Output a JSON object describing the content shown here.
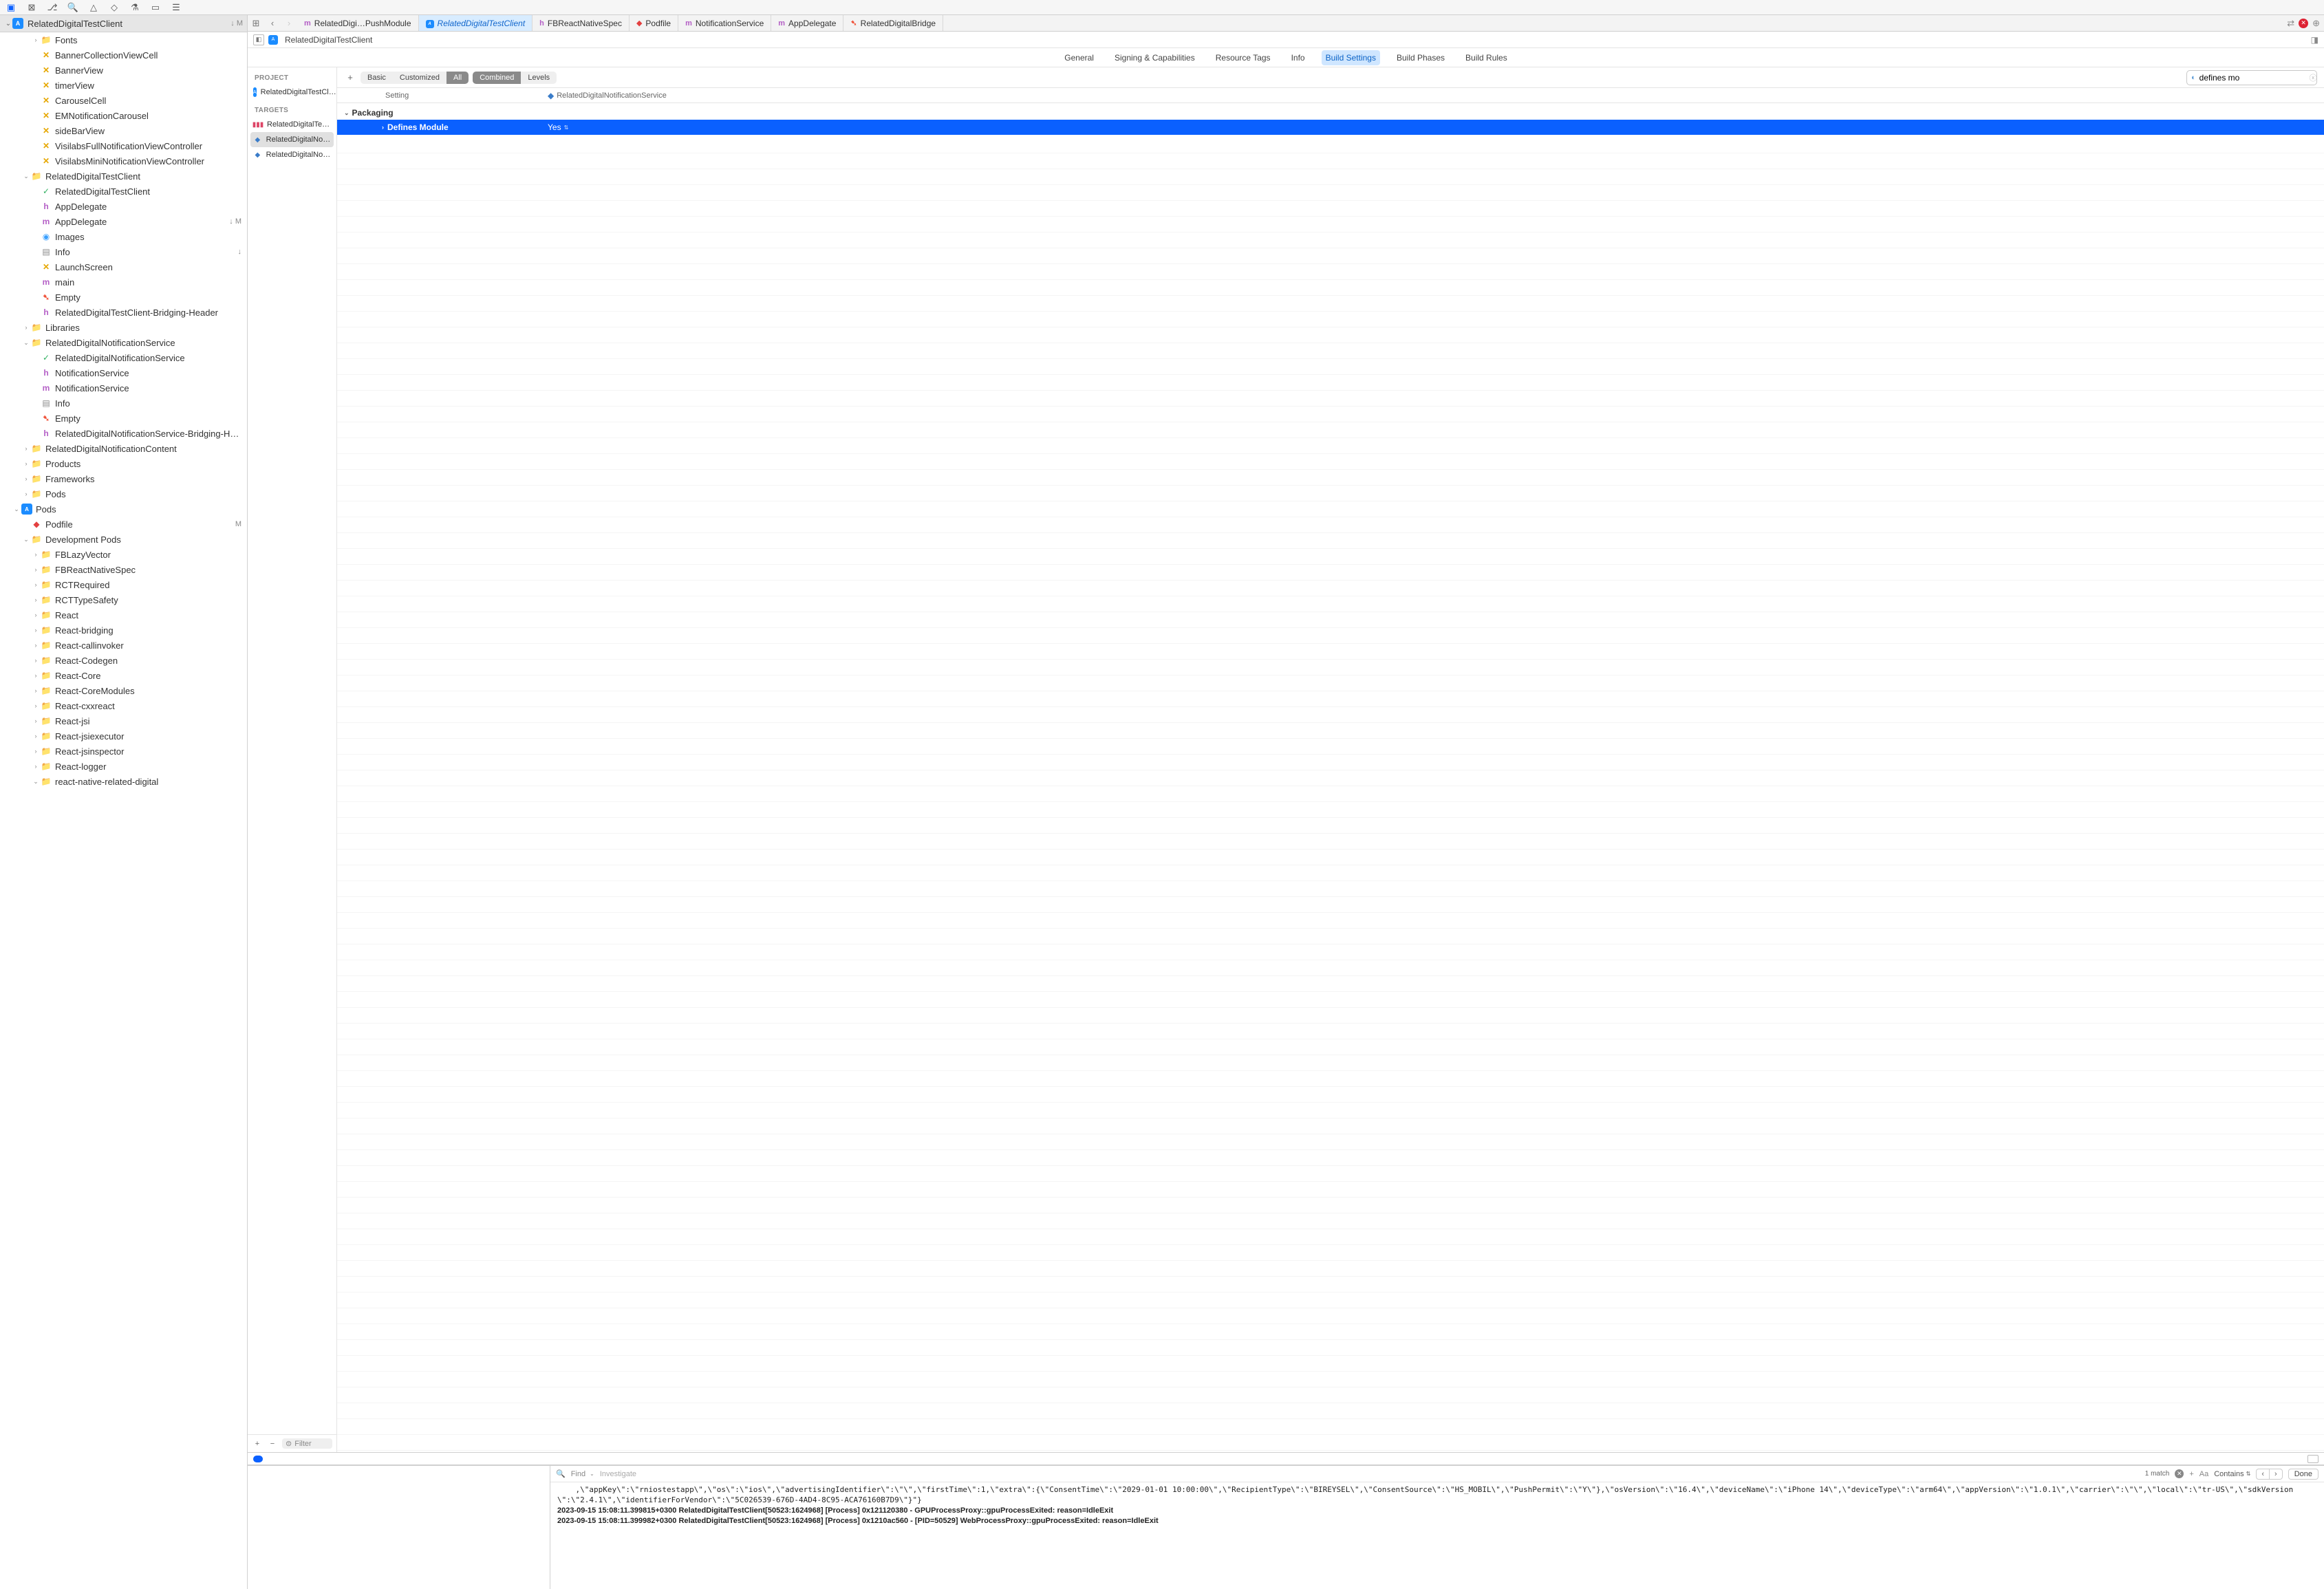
{
  "toolbar_icons": [
    "finder",
    "square-x",
    "branch",
    "search",
    "warn",
    "tag",
    "flask",
    "rect",
    "panel"
  ],
  "project_header": {
    "name": "RelatedDigitalTestClient",
    "status": "↓ M"
  },
  "nav_tree": [
    {
      "indent": 1,
      "disc": "›",
      "icon": "folder",
      "label": "Fonts"
    },
    {
      "indent": 1,
      "disc": "",
      "icon": "xib",
      "label": "BannerCollectionViewCell"
    },
    {
      "indent": 1,
      "disc": "",
      "icon": "xib",
      "label": "BannerView"
    },
    {
      "indent": 1,
      "disc": "",
      "icon": "xib",
      "label": "timerView"
    },
    {
      "indent": 1,
      "disc": "",
      "icon": "xib",
      "label": "CarouselCell"
    },
    {
      "indent": 1,
      "disc": "",
      "icon": "xib",
      "label": "EMNotificationCarousel"
    },
    {
      "indent": 1,
      "disc": "",
      "icon": "xib",
      "label": "sideBarView"
    },
    {
      "indent": 1,
      "disc": "",
      "icon": "xib",
      "label": "VisilabsFullNotificationViewController"
    },
    {
      "indent": 1,
      "disc": "",
      "icon": "xib",
      "label": "VisilabsMiniNotificationViewController"
    },
    {
      "indent": 0,
      "disc": "⌄",
      "icon": "folder",
      "label": "RelatedDigitalTestClient"
    },
    {
      "indent": 1,
      "disc": "",
      "icon": "entitle",
      "label": "RelatedDigitalTestClient"
    },
    {
      "indent": 1,
      "disc": "",
      "icon": "h",
      "label": "AppDelegate"
    },
    {
      "indent": 1,
      "disc": "",
      "icon": "m",
      "label": "AppDelegate",
      "status": "↓ M"
    },
    {
      "indent": 1,
      "disc": "",
      "icon": "assets",
      "label": "Images"
    },
    {
      "indent": 1,
      "disc": "",
      "icon": "plist",
      "label": "Info",
      "status": "↓"
    },
    {
      "indent": 1,
      "disc": "",
      "icon": "xib",
      "label": "LaunchScreen"
    },
    {
      "indent": 1,
      "disc": "",
      "icon": "m",
      "label": "main"
    },
    {
      "indent": 1,
      "disc": "",
      "icon": "swift",
      "label": "Empty"
    },
    {
      "indent": 1,
      "disc": "",
      "icon": "h",
      "label": "RelatedDigitalTestClient-Bridging-Header"
    },
    {
      "indent": 0,
      "disc": "›",
      "icon": "folder",
      "label": "Libraries"
    },
    {
      "indent": 0,
      "disc": "⌄",
      "icon": "folder",
      "label": "RelatedDigitalNotificationService"
    },
    {
      "indent": 1,
      "disc": "",
      "icon": "entitle",
      "label": "RelatedDigitalNotificationService"
    },
    {
      "indent": 1,
      "disc": "",
      "icon": "h",
      "label": "NotificationService"
    },
    {
      "indent": 1,
      "disc": "",
      "icon": "m",
      "label": "NotificationService"
    },
    {
      "indent": 1,
      "disc": "",
      "icon": "plist",
      "label": "Info"
    },
    {
      "indent": 1,
      "disc": "",
      "icon": "swift",
      "label": "Empty"
    },
    {
      "indent": 1,
      "disc": "",
      "icon": "h",
      "label": "RelatedDigitalNotificationService-Bridging-Header"
    },
    {
      "indent": 0,
      "disc": "›",
      "icon": "folder",
      "label": "RelatedDigitalNotificationContent"
    },
    {
      "indent": 0,
      "disc": "›",
      "icon": "folder",
      "label": "Products"
    },
    {
      "indent": 0,
      "disc": "›",
      "icon": "folder",
      "label": "Frameworks"
    },
    {
      "indent": 0,
      "disc": "›",
      "icon": "folder",
      "label": "Pods"
    },
    {
      "indent": -1,
      "disc": "⌄",
      "icon": "app",
      "label": "Pods"
    },
    {
      "indent": 0,
      "disc": "",
      "icon": "pods",
      "label": "Podfile",
      "status": "M"
    },
    {
      "indent": 0,
      "disc": "⌄",
      "icon": "folder",
      "label": "Development Pods"
    },
    {
      "indent": 1,
      "disc": "›",
      "icon": "folder",
      "label": "FBLazyVector"
    },
    {
      "indent": 1,
      "disc": "›",
      "icon": "folder",
      "label": "FBReactNativeSpec"
    },
    {
      "indent": 1,
      "disc": "›",
      "icon": "folder",
      "label": "RCTRequired"
    },
    {
      "indent": 1,
      "disc": "›",
      "icon": "folder",
      "label": "RCTTypeSafety"
    },
    {
      "indent": 1,
      "disc": "›",
      "icon": "folder",
      "label": "React"
    },
    {
      "indent": 1,
      "disc": "›",
      "icon": "folder",
      "label": "React-bridging"
    },
    {
      "indent": 1,
      "disc": "›",
      "icon": "folder",
      "label": "React-callinvoker"
    },
    {
      "indent": 1,
      "disc": "›",
      "icon": "folder",
      "label": "React-Codegen"
    },
    {
      "indent": 1,
      "disc": "›",
      "icon": "folder",
      "label": "React-Core"
    },
    {
      "indent": 1,
      "disc": "›",
      "icon": "folder",
      "label": "React-CoreModules"
    },
    {
      "indent": 1,
      "disc": "›",
      "icon": "folder",
      "label": "React-cxxreact"
    },
    {
      "indent": 1,
      "disc": "›",
      "icon": "folder",
      "label": "React-jsi"
    },
    {
      "indent": 1,
      "disc": "›",
      "icon": "folder",
      "label": "React-jsiexecutor"
    },
    {
      "indent": 1,
      "disc": "›",
      "icon": "folder",
      "label": "React-jsinspector"
    },
    {
      "indent": 1,
      "disc": "›",
      "icon": "folder",
      "label": "React-logger"
    },
    {
      "indent": 1,
      "disc": "⌄",
      "icon": "folder",
      "label": "react-native-related-digital"
    }
  ],
  "tabs": [
    {
      "icon": "m",
      "label": "RelatedDigi…PushModule"
    },
    {
      "icon": "app",
      "label": "RelatedDigitalTestClient",
      "active": true
    },
    {
      "icon": "h",
      "label": "FBReactNativeSpec"
    },
    {
      "icon": "pods",
      "label": "Podfile"
    },
    {
      "icon": "m",
      "label": "NotificationService"
    },
    {
      "icon": "m",
      "label": "AppDelegate"
    },
    {
      "icon": "swift",
      "label": "RelatedDigitalBridge"
    }
  ],
  "breadcrumb": {
    "project": "RelatedDigitalTestClient"
  },
  "config_tabs": [
    "General",
    "Signing & Capabilities",
    "Resource Tags",
    "Info",
    "Build Settings",
    "Build Phases",
    "Build Rules"
  ],
  "config_active": "Build Settings",
  "filter_bar": {
    "seg1": [
      "Basic",
      "Customized",
      "All"
    ],
    "seg1_active": "All",
    "seg2": [
      "Combined",
      "Levels"
    ],
    "seg2_active": "Combined",
    "search_value": "defines mo"
  },
  "targets_panel": {
    "project_label": "PROJECT",
    "project_item": "RelatedDigitalTestCl…",
    "targets_label": "TARGETS",
    "targets": [
      {
        "icon": "bars",
        "label": "RelatedDigitalTestCl…"
      },
      {
        "icon": "ext",
        "label": "RelatedDigitalNotifi…",
        "selected": true
      },
      {
        "icon": "ext",
        "label": "RelatedDigitalNotifi…"
      }
    ],
    "filter_placeholder": "Filter"
  },
  "settings_table": {
    "header_setting": "Setting",
    "header_target": "RelatedDigitalNotificationService",
    "section": "Packaging",
    "row_name": "Defines Module",
    "row_value": "Yes"
  },
  "console_toolbar": {
    "find_label": "Find",
    "investigate_label": "Investigate",
    "matches": "1 match",
    "aa": "Aa",
    "contains": "Contains",
    "done": "Done"
  },
  "console_text": ",\\\"appKey\\\":\\\"rniostestapp\\\",\\\"os\\\":\\\"ios\\\",\\\"advertisingIdentifier\\\":\\\"\\\",\\\"firstTime\\\":1,\\\"extra\\\":{\\\"ConsentTime\\\":\\\"2029-01-01 10:00:00\\\",\\\"RecipientType\\\":\\\"BIREYSEL\\\",\\\"ConsentSource\\\":\\\"HS_MOBIL\\\",\\\"PushPermit\\\":\\\"Y\\\"},\\\"osVersion\\\":\\\"16.4\\\",\\\"deviceName\\\":\\\"iPhone 14\\\",\\\"deviceType\\\":\\\"arm64\\\",\\\"appVersion\\\":\\\"1.0.1\\\",\\\"carrier\\\":\\\"\\\",\\\"local\\\":\\\"tr-US\\\",\\\"sdkVersion\\\":\\\"2.4.1\\\",\\\"identifierForVendor\\\":\\\"5C026539-676D-4AD4-8C95-ACA76160B7D9\\\"}\"}\n2023-09-15 15:08:11.399815+0300 RelatedDigitalTestClient[50523:1624968] [Process] 0x121120380 - GPUProcessProxy::gpuProcessExited: reason=IdleExit\n2023-09-15 15:08:11.399982+0300 RelatedDigitalTestClient[50523:1624968] [Process] 0x1210ac560 - [PID=50529] WebProcessProxy::gpuProcessExited: reason=IdleExit"
}
